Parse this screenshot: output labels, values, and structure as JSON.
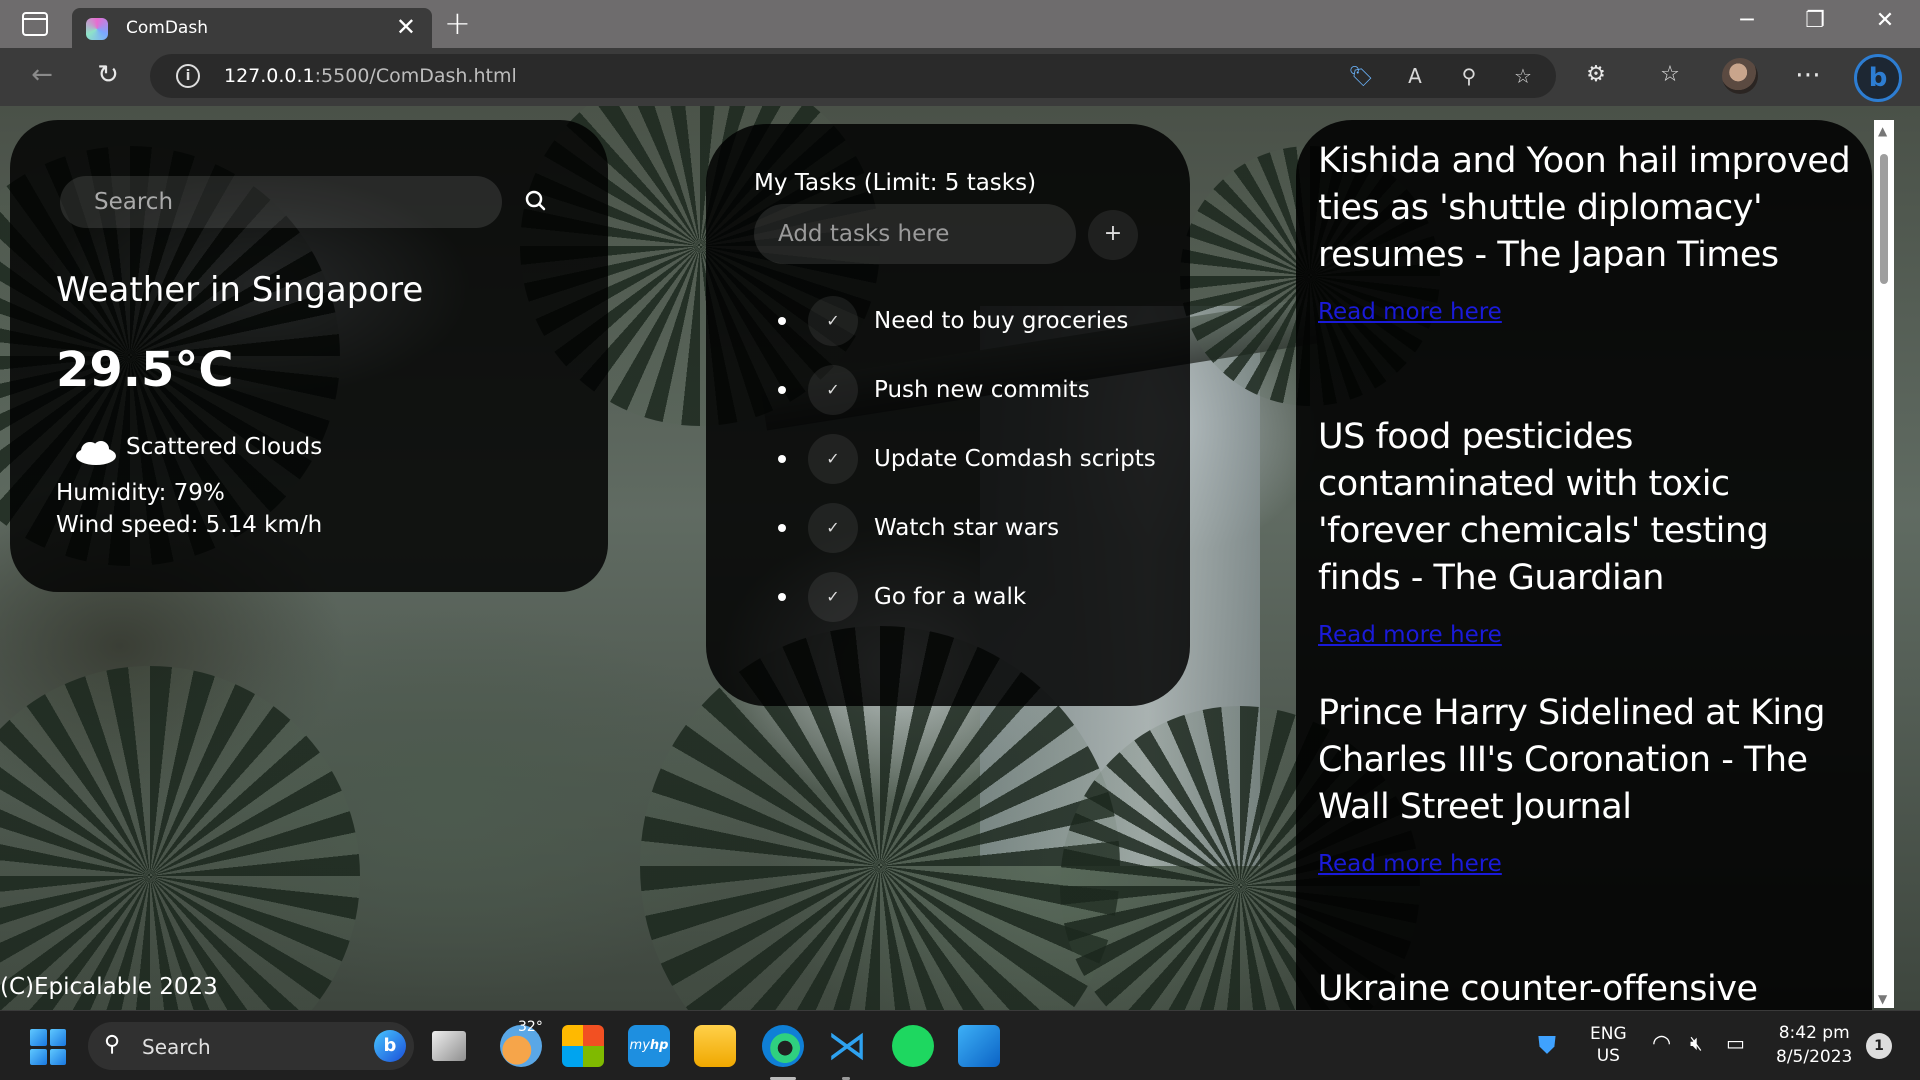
{
  "browser": {
    "tab_title": "ComDash",
    "url_host": "127.0.0.1",
    "url_rest": ":5500/ComDash.html"
  },
  "weather": {
    "search_placeholder": "Search",
    "title": "Weather in Singapore",
    "temperature": "29.5°C",
    "description": "Scattered Clouds",
    "humidity": "Humidity: 79%",
    "wind": "Wind speed: 5.14 km/h"
  },
  "tasks": {
    "header": "My Tasks (Limit: 5 tasks)",
    "input_placeholder": "Add tasks here",
    "add_label": "+",
    "items": [
      "Need to buy groceries",
      "Push new commits",
      "Update Comdash scripts",
      "Watch star wars",
      "Go for a walk"
    ]
  },
  "news": {
    "items": [
      {
        "title": "Kishida and Yoon hail improved ties as 'shuttle diplomacy' resumes - The Japan Times",
        "link": "Read more here"
      },
      {
        "title": "US food pesticides contaminated with toxic 'forever chemicals' testing finds - The Guardian",
        "link": "Read more here"
      },
      {
        "title": "Prince Harry Sidelined at King Charles III's Coronation - The Wall Street Journal",
        "link": "Read more here"
      },
      {
        "title": "Ukraine counter-offensive",
        "link": ""
      }
    ]
  },
  "footer": "(C)Epicalable 2023",
  "taskbar": {
    "search_label": "Search",
    "weather_temp": "32°",
    "lang_top": "ENG",
    "lang_bottom": "US",
    "time": "8:42 pm",
    "date": "8/5/2023",
    "notification_count": "1"
  },
  "colors": {
    "link": "#1a1ad9",
    "card_bg": "#000000",
    "accent": "#2d7dd2"
  }
}
